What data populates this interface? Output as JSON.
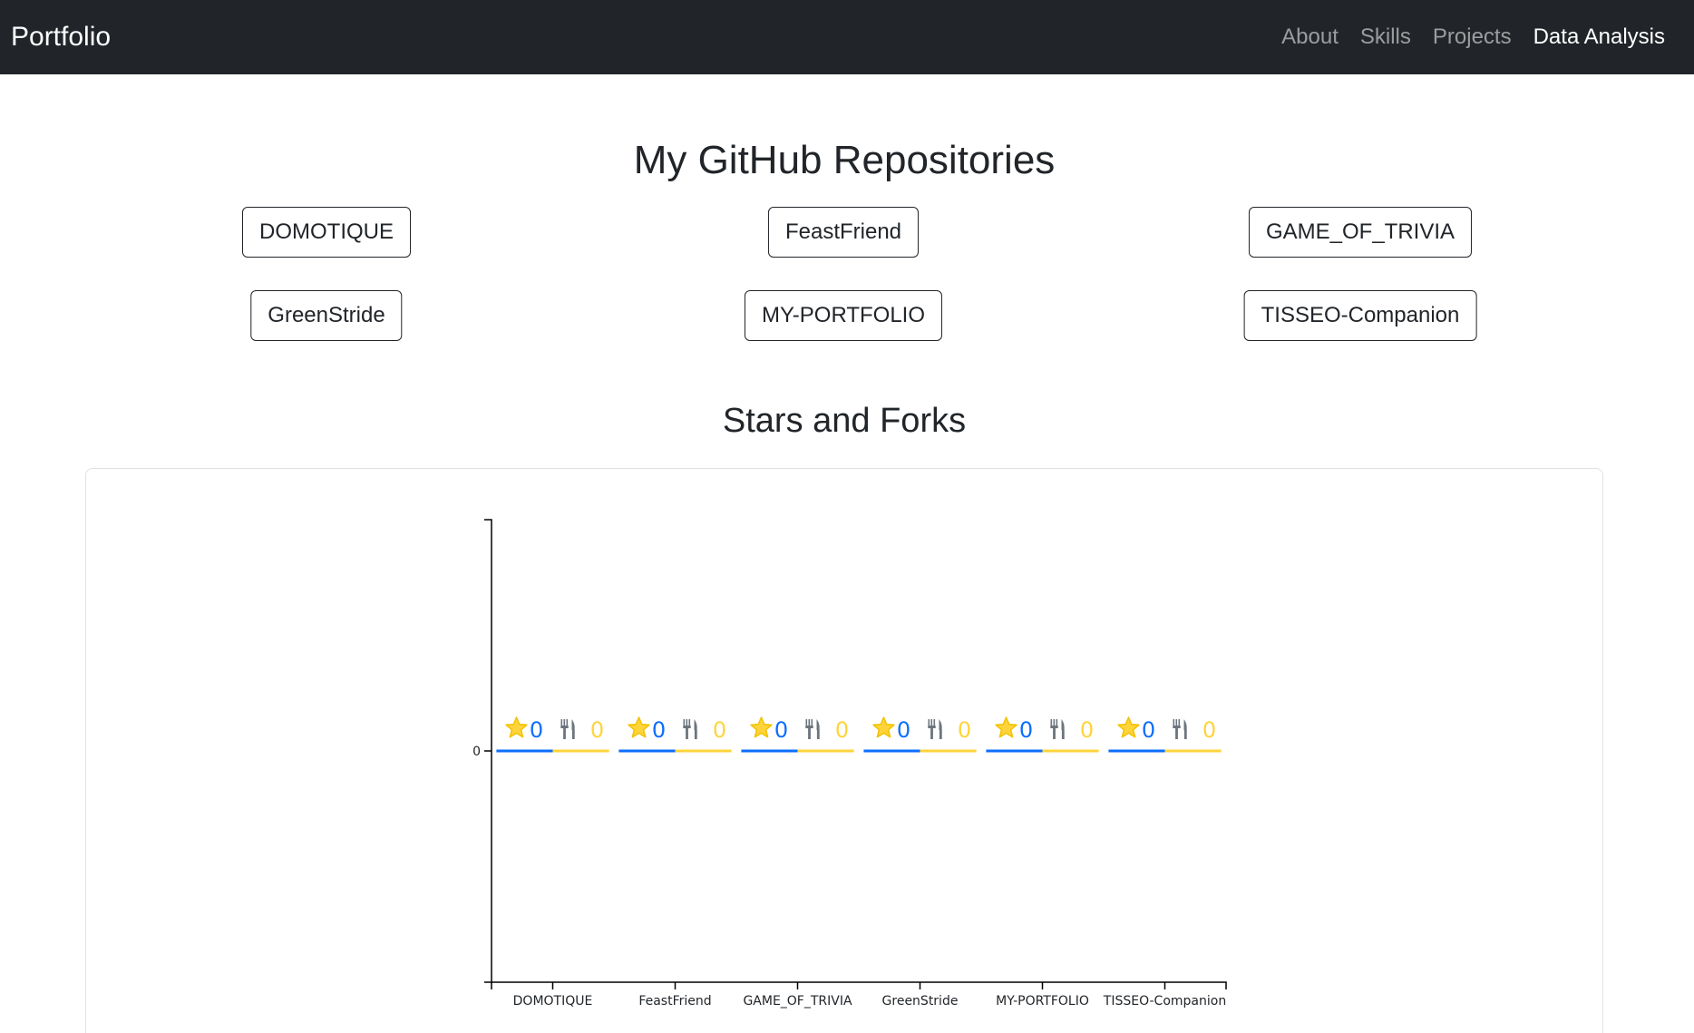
{
  "navbar": {
    "brand": "Portfolio",
    "links": [
      {
        "label": "About",
        "active": false
      },
      {
        "label": "Skills",
        "active": false
      },
      {
        "label": "Projects",
        "active": false
      },
      {
        "label": "Data Analysis",
        "active": true
      }
    ]
  },
  "main": {
    "title": "My GitHub Repositories",
    "repos": [
      "DOMOTIQUE",
      "FeastFriend",
      "GAME_OF_TRIVIA",
      "GreenStride",
      "MY-PORTFOLIO",
      "TISSEO-Companion"
    ],
    "chart_section_title": "Stars and Forks"
  },
  "icons": {
    "star": "star-icon",
    "fork": "fork-knife-icon"
  },
  "colors": {
    "stars": "#0d6efd",
    "forks": "#ffd43b",
    "navbar_bg": "#212529"
  },
  "chart_data": {
    "type": "bar",
    "categories": [
      "DOMOTIQUE",
      "FeastFriend",
      "GAME_OF_TRIVIA",
      "GreenStride",
      "MY-PORTFOLIO",
      "TISSEO-Companion"
    ],
    "series": [
      {
        "key": "stars",
        "values": [
          0,
          0,
          0,
          0,
          0,
          0
        ]
      },
      {
        "key": "forks",
        "values": [
          0,
          0,
          0,
          0,
          0,
          0
        ]
      }
    ],
    "y_ticks": [
      "0"
    ],
    "grid": false
  }
}
